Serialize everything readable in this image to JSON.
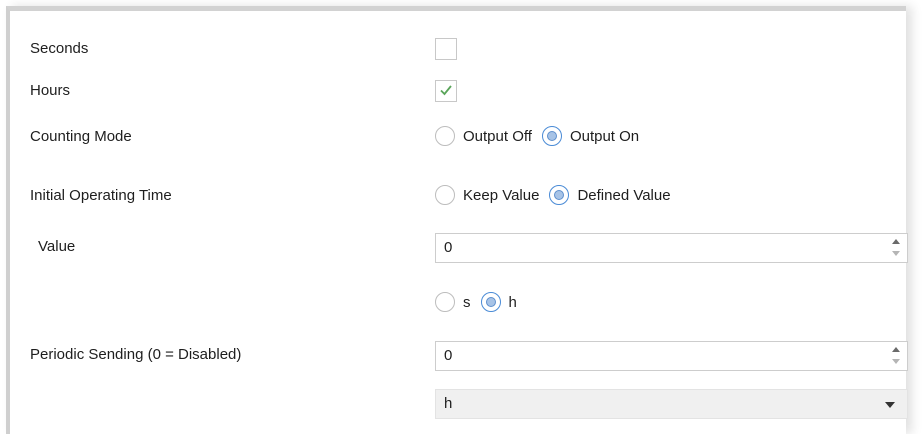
{
  "rows": {
    "seconds": {
      "label": "Seconds",
      "checked": false
    },
    "hours": {
      "label": "Hours",
      "checked": true
    },
    "counting_mode": {
      "label": "Counting Mode",
      "options": [
        "Output Off",
        "Output On"
      ],
      "selected": "Output On"
    },
    "initial_operating_time": {
      "label": "Initial Operating Time",
      "options": [
        "Keep Value",
        "Defined Value"
      ],
      "selected": "Defined Value"
    },
    "value": {
      "label": "Value",
      "input_value": "0"
    },
    "unit": {
      "options": [
        "s",
        "h"
      ],
      "selected": "h"
    },
    "periodic_sending": {
      "label": "Periodic Sending (0 = Disabled)",
      "input_value": "0"
    },
    "periodic_unit": {
      "selected_value": "h"
    }
  },
  "colors": {
    "check": "#5aa55a",
    "radio_accent": "#4a8bd6"
  }
}
